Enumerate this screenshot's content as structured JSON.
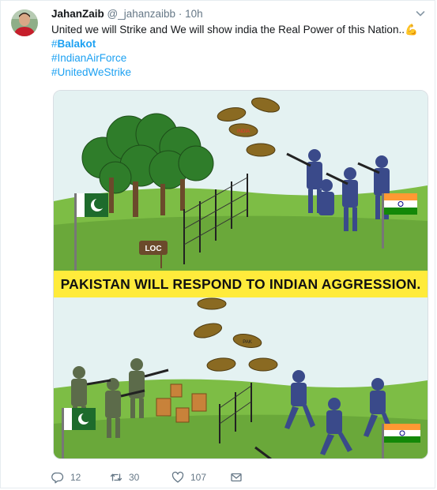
{
  "tweet": {
    "author_name": "JahanZaib",
    "author_handle": "@_jahanzaibb",
    "separator": "·",
    "time": "10h",
    "text": "United we will Strike and We will show india the Real Power of this Nation..",
    "text_emoji": "💪",
    "hashtags": [
      {
        "hash": "#",
        "tag": "Balakot",
        "bold": true
      },
      {
        "hash": "#",
        "tag": "IndianAirForce",
        "bold": false
      },
      {
        "hash": "#",
        "tag": "UnitedWeStrike",
        "bold": false
      }
    ]
  },
  "media": {
    "banner_text": "PAKISTAN WILL RESPOND TO INDIAN AGGRESSION.",
    "loc_sign": "LOC",
    "shell_label_top": "INDIA",
    "shell_label_bottom": "PAK"
  },
  "actions": {
    "replies": "12",
    "retweets": "30",
    "likes": "107"
  },
  "colors": {
    "link": "#1da1f2",
    "muted": "#657786",
    "banner": "#ffeb3b",
    "grass": "#6fb33a",
    "sky": "#e4f2f2"
  },
  "icons": [
    "chevron-down-icon",
    "reply-icon",
    "retweet-icon",
    "like-icon",
    "message-icon",
    "muscle-emoji-icon"
  ]
}
